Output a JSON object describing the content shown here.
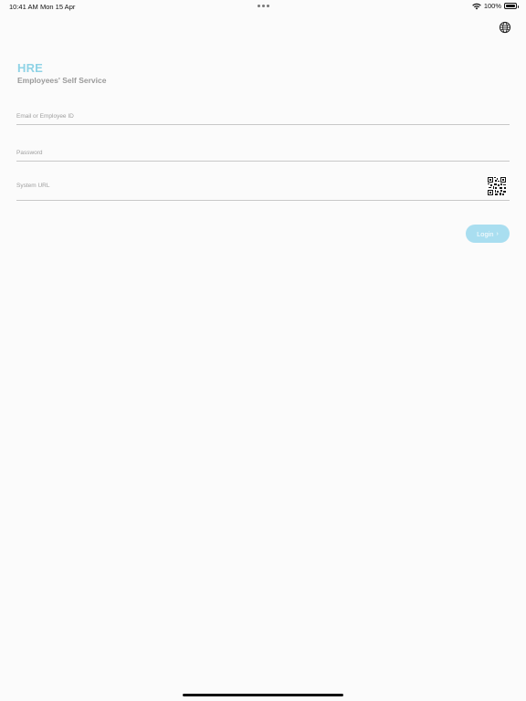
{
  "status_bar": {
    "time": "10:41 AM",
    "date": "Mon 15 Apr",
    "battery": "100%"
  },
  "header": {
    "language_icon": "globe-icon"
  },
  "brand": {
    "title": "HRE",
    "subtitle": "Employees' Self Service",
    "accent_color": "#8fd3e6"
  },
  "form": {
    "email_placeholder": "Email or Employee ID",
    "email_value": "",
    "password_placeholder": "Password",
    "password_value": "",
    "url_placeholder": "System URL",
    "url_value": "",
    "qr_icon": "qr-code-icon"
  },
  "login": {
    "label": "Login",
    "icon": "chevron-right-icon",
    "color": "#a9def0"
  }
}
